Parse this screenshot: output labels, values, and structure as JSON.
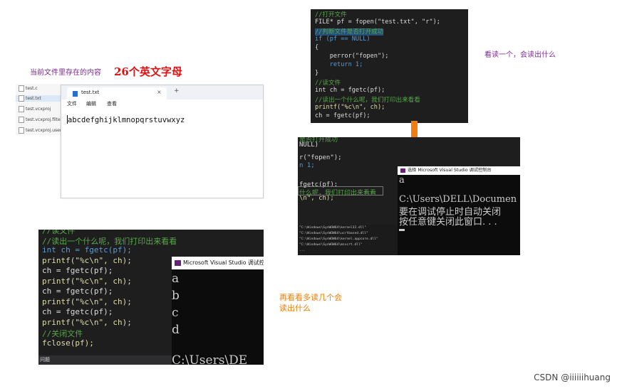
{
  "annotations": {
    "current_content_label": "当前文件里存在的内容",
    "letters_label": "26个英文字母",
    "read_one_label": "看读一个，会读出什么",
    "read_more_line1": "再看看多读几个会",
    "read_more_line2": "读出什么"
  },
  "explorer": {
    "items": [
      "test.c",
      "test.txt",
      "test.vcxproj",
      "test.vcxproj.filters",
      "test.vcxproj.user"
    ]
  },
  "notepad": {
    "tab_title": "test.txt",
    "close_glyph": "×",
    "plus_glyph": "+",
    "menu": [
      "文件",
      "编辑",
      "查看"
    ],
    "content": "abcdefghijklmnopqrstuvwxyz"
  },
  "code_top": {
    "lines": [
      "//打开文件",
      "FILE* pf = fopen(\"test.txt\", \"r\");",
      "//判断文件是否打开成功",
      "if (pf == NULL)",
      "{",
      "    perror(\"fopen\");",
      "    return 1;",
      "}",
      "//读文件",
      "int ch = fgetc(pf);",
      "//读出一个什么呢，我们打印出来看看",
      "printf(\"%c\\n\", ch);",
      "ch = fgetc(pf);"
    ]
  },
  "code_mid": {
    "lines": [
      "是否打开成功",
      "NULL)",
      "r(\"fopen\");",
      "n 1;",
      "fgetc(pf);",
      "什么呢，我们打印出来看看",
      "\\n\", ch);"
    ],
    "output_lines": [
      "\"C:\\Windows\\SysWOW64\\kernel32.dll\"",
      "\"C:\\Windows\\SysWOW64\\ucrtbased.dll\"",
      "\"C:\\Windows\\SysWOW64\\kernel.appcore.dll\"",
      "\"C:\\Windows\\SysWOW64\\msvcrt.dll\"",
      "..."
    ]
  },
  "console_one": {
    "title": "选择 Microsoft Visual Studio 调试控制台",
    "lines": [
      "a",
      "",
      "C:\\Users\\DELL\\Documen",
      "要在调试停止时自动关闭",
      "按任意键关闭此窗口. . ."
    ]
  },
  "code_bottom": {
    "lines": [
      "//读文件",
      "//读出一个什么呢，我们打印出来看看",
      "int ch = fgetc(pf);",
      "printf(\"%c\\n\", ch);",
      "ch = fgetc(pf);",
      "printf(\"%c\\n\", ch);",
      "ch = fgetc(pf);",
      "printf(\"%c\\n\", ch);",
      "ch = fgetc(pf);",
      "printf(\"%c\\n\", ch);",
      "//关闭文件",
      "fclose(pf);"
    ],
    "status_text": "问题"
  },
  "console_two": {
    "title": "Microsoft Visual Studio 调试控",
    "lines": [
      "a",
      "b",
      "c",
      "d",
      "",
      "C:\\Users\\DE"
    ]
  },
  "watermark": "CSDN @iiiiiihuang",
  "colors": {
    "annotation_purple": "#7b2c8f",
    "annotation_red": "#e01010",
    "annotation_orange": "#f07d00",
    "arrow": "#f07d10",
    "code_bg": "#1e1e1e",
    "comment": "#57a64a",
    "keyword": "#569cd6"
  }
}
